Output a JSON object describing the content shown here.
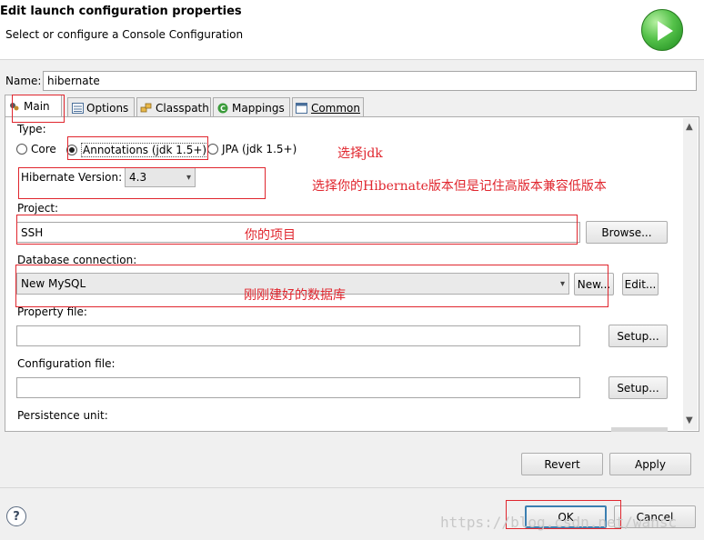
{
  "dialog": {
    "title": "Edit launch configuration properties",
    "subtitle": "Select or configure a Console Configuration",
    "logo_icon": "run-launch-icon"
  },
  "name_field": {
    "label": "Name:",
    "value": "hibernate"
  },
  "tabs": [
    {
      "label": "Main",
      "icon": "main-tab-icon"
    },
    {
      "label": "Options",
      "icon": "options-icon"
    },
    {
      "label": "Classpath",
      "icon": "classpath-icon"
    },
    {
      "label": "Mappings",
      "icon": "mappings-icon"
    },
    {
      "label": "Common",
      "icon": "common-icon"
    }
  ],
  "main": {
    "type_label": "Type:",
    "type_options": [
      "Core",
      "Annotations (jdk 1.5+)",
      "JPA (jdk 1.5+)"
    ],
    "selected_type": "Annotations (jdk 1.5+)",
    "hibernate_version_label": "Hibernate Version:",
    "hibernate_version_value": "4.3",
    "project_label": "Project:",
    "project_value": "SSH",
    "browse_label": "Browse...",
    "db_label": "Database connection:",
    "db_value": "New MySQL",
    "new_label": "New...",
    "edit_label": "Edit...",
    "property_label": "Property file:",
    "property_value": "",
    "config_label": "Configuration file:",
    "config_value": "",
    "setup_label": "Setup...",
    "persistence_label": "Persistence unit:"
  },
  "annotations": {
    "jdk": "选择jdk",
    "version": "选择你的Hibernate版本但是记住高版本兼容低版本",
    "project": "你的项目",
    "db": "刚刚建好的数据库"
  },
  "footer": {
    "revert_label": "Revert",
    "apply_label": "Apply",
    "ok_label": "OK",
    "cancel_label": "Cancel",
    "help_label": "?"
  },
  "watermark": "https://blog.csdn.net/wansc",
  "colors": {
    "annotation_red": "#e0262e",
    "ok_focus": "#3c7fb1"
  }
}
